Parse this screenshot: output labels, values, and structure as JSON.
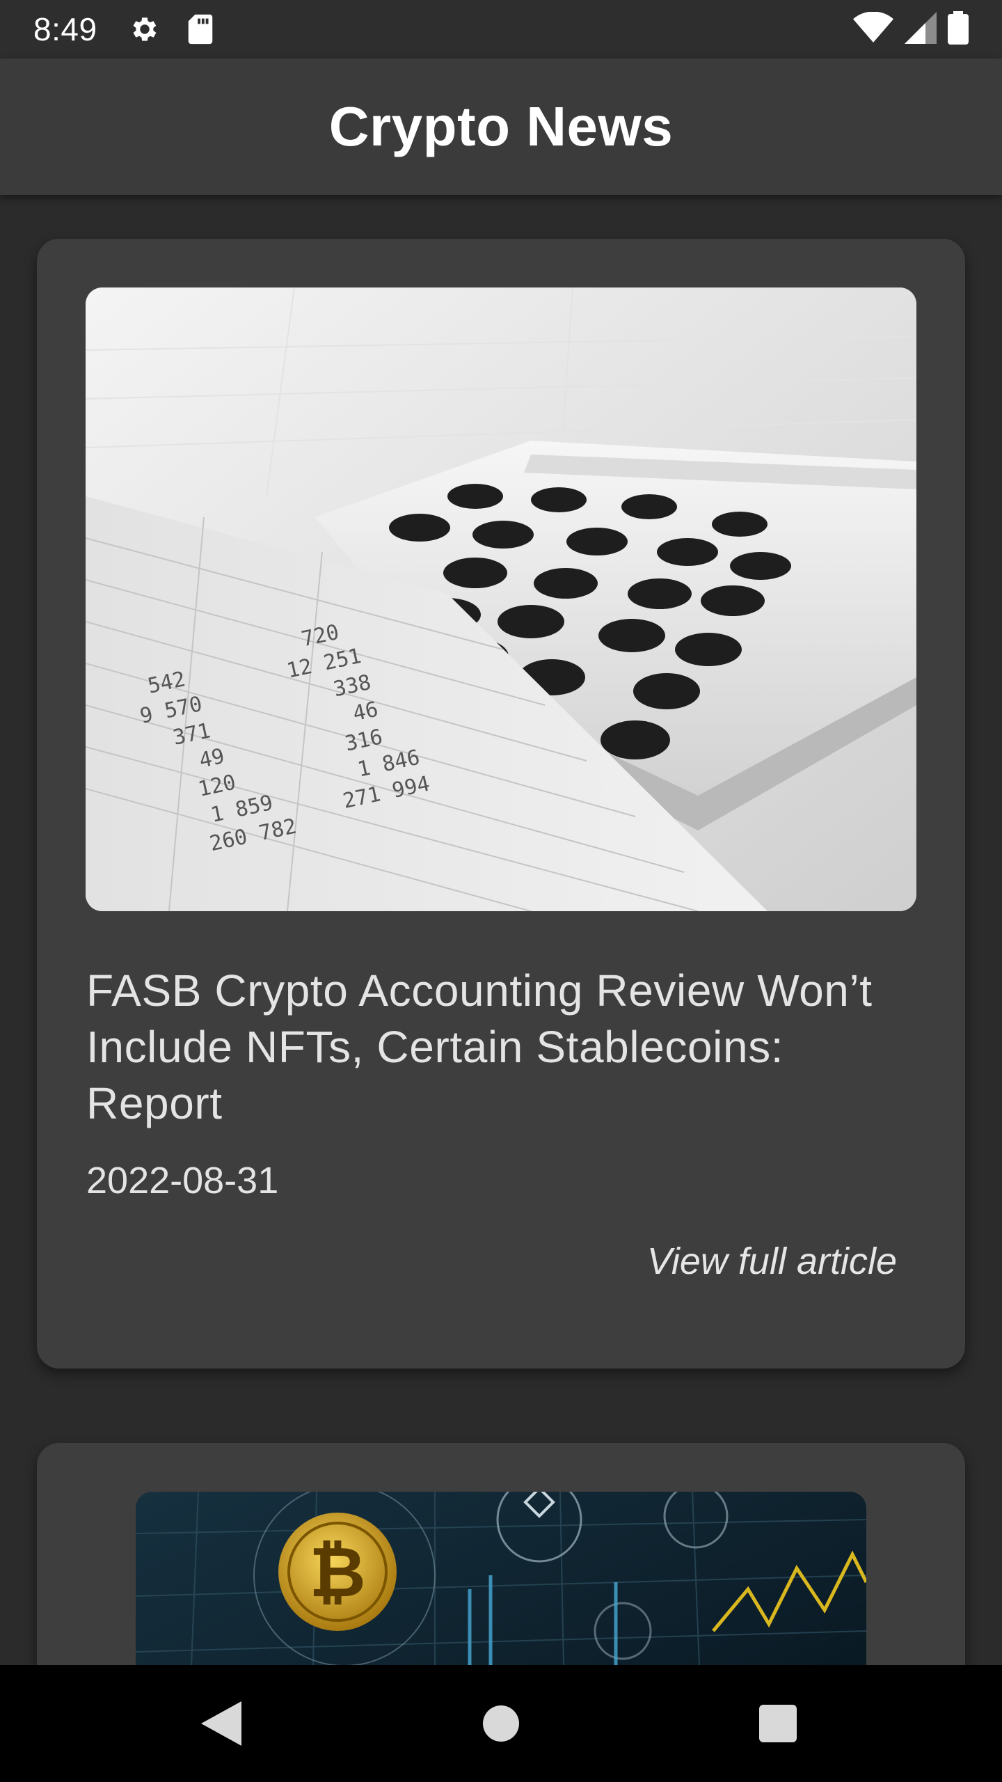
{
  "status_bar": {
    "time": "8:49",
    "icons": [
      "gear-icon",
      "sd-card-icon",
      "wifi-icon",
      "signal-icon",
      "battery-icon"
    ]
  },
  "app_bar": {
    "title": "Crypto News"
  },
  "articles": [
    {
      "image_icon": "calculator-spreadsheet-photo",
      "headline": "FASB Crypto Accounting Review Won’t Include NFTs, Certain Stablecoins: Report",
      "date": "2022-08-31",
      "link_label": "View full article"
    },
    {
      "image_icon": "bitcoin-chart-photo"
    }
  ],
  "nav_bar": {
    "icons": [
      "back-icon",
      "home-icon",
      "recents-icon"
    ]
  },
  "colors": {
    "background": "#2b2b2b",
    "status_bar": "#2e2e2e",
    "app_bar": "#3b3b3b",
    "card": "#3e3e3e",
    "text": "#e4e4e4",
    "nav_bar": "#000000",
    "bitcoin_gold": "#d9a520"
  }
}
